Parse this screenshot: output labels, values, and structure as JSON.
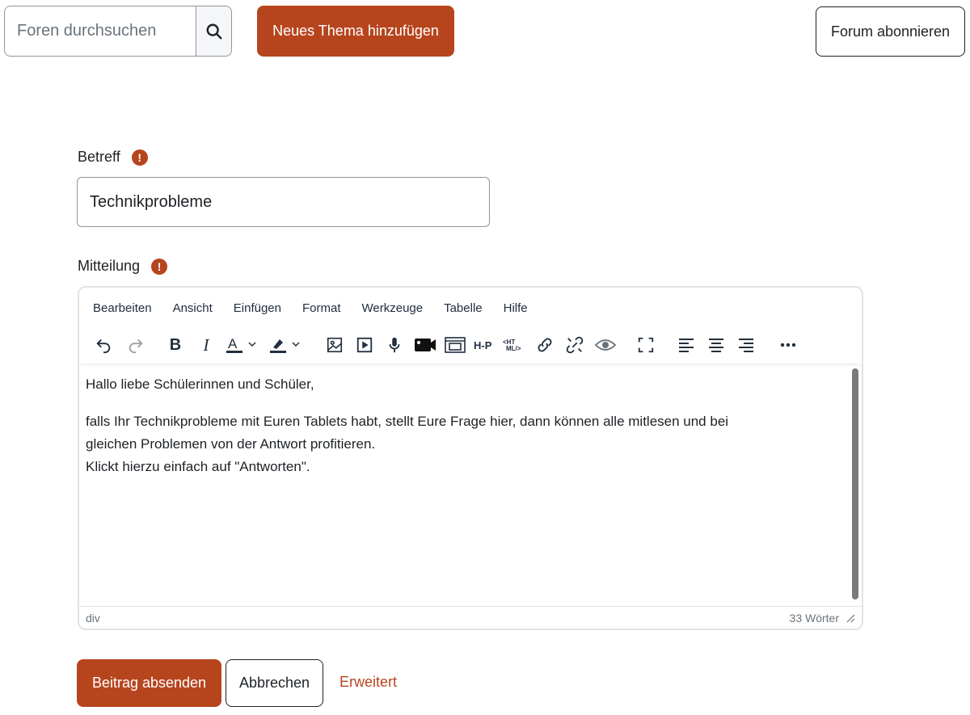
{
  "search": {
    "placeholder": "Foren durchsuchen"
  },
  "header": {
    "new_topic_label": "Neues Thema hinzufügen",
    "subscribe_label": "Forum abonnieren"
  },
  "form": {
    "subject_label": "Betreff",
    "subject_value": "Technikprobleme",
    "message_label": "Mitteilung",
    "required_marker": "!"
  },
  "editor": {
    "menu": [
      "Bearbeiten",
      "Ansicht",
      "Einfügen",
      "Format",
      "Werkzeuge",
      "Tabelle",
      "Hilfe"
    ],
    "content": {
      "p1": "Hallo liebe Schülerinnen und Schüler,",
      "p2_line1": "falls Ihr Technikprobleme mit Euren Tablets habt, stellt Eure Frage hier, dann können alle mitlesen und bei",
      "p2_line2": "gleichen Problemen von der Antwort profitieren.",
      "p2_line3": "Klickt hierzu einfach auf \"Antworten\"."
    },
    "status_path": "div",
    "word_count": "33 Wörter"
  },
  "actions": {
    "submit_label": "Beitrag absenden",
    "cancel_label": "Abbrechen",
    "advanced_label": "Erweitert"
  },
  "colors": {
    "accent": "#b6451e",
    "text": "#1d2125",
    "border": "#8f959e"
  }
}
